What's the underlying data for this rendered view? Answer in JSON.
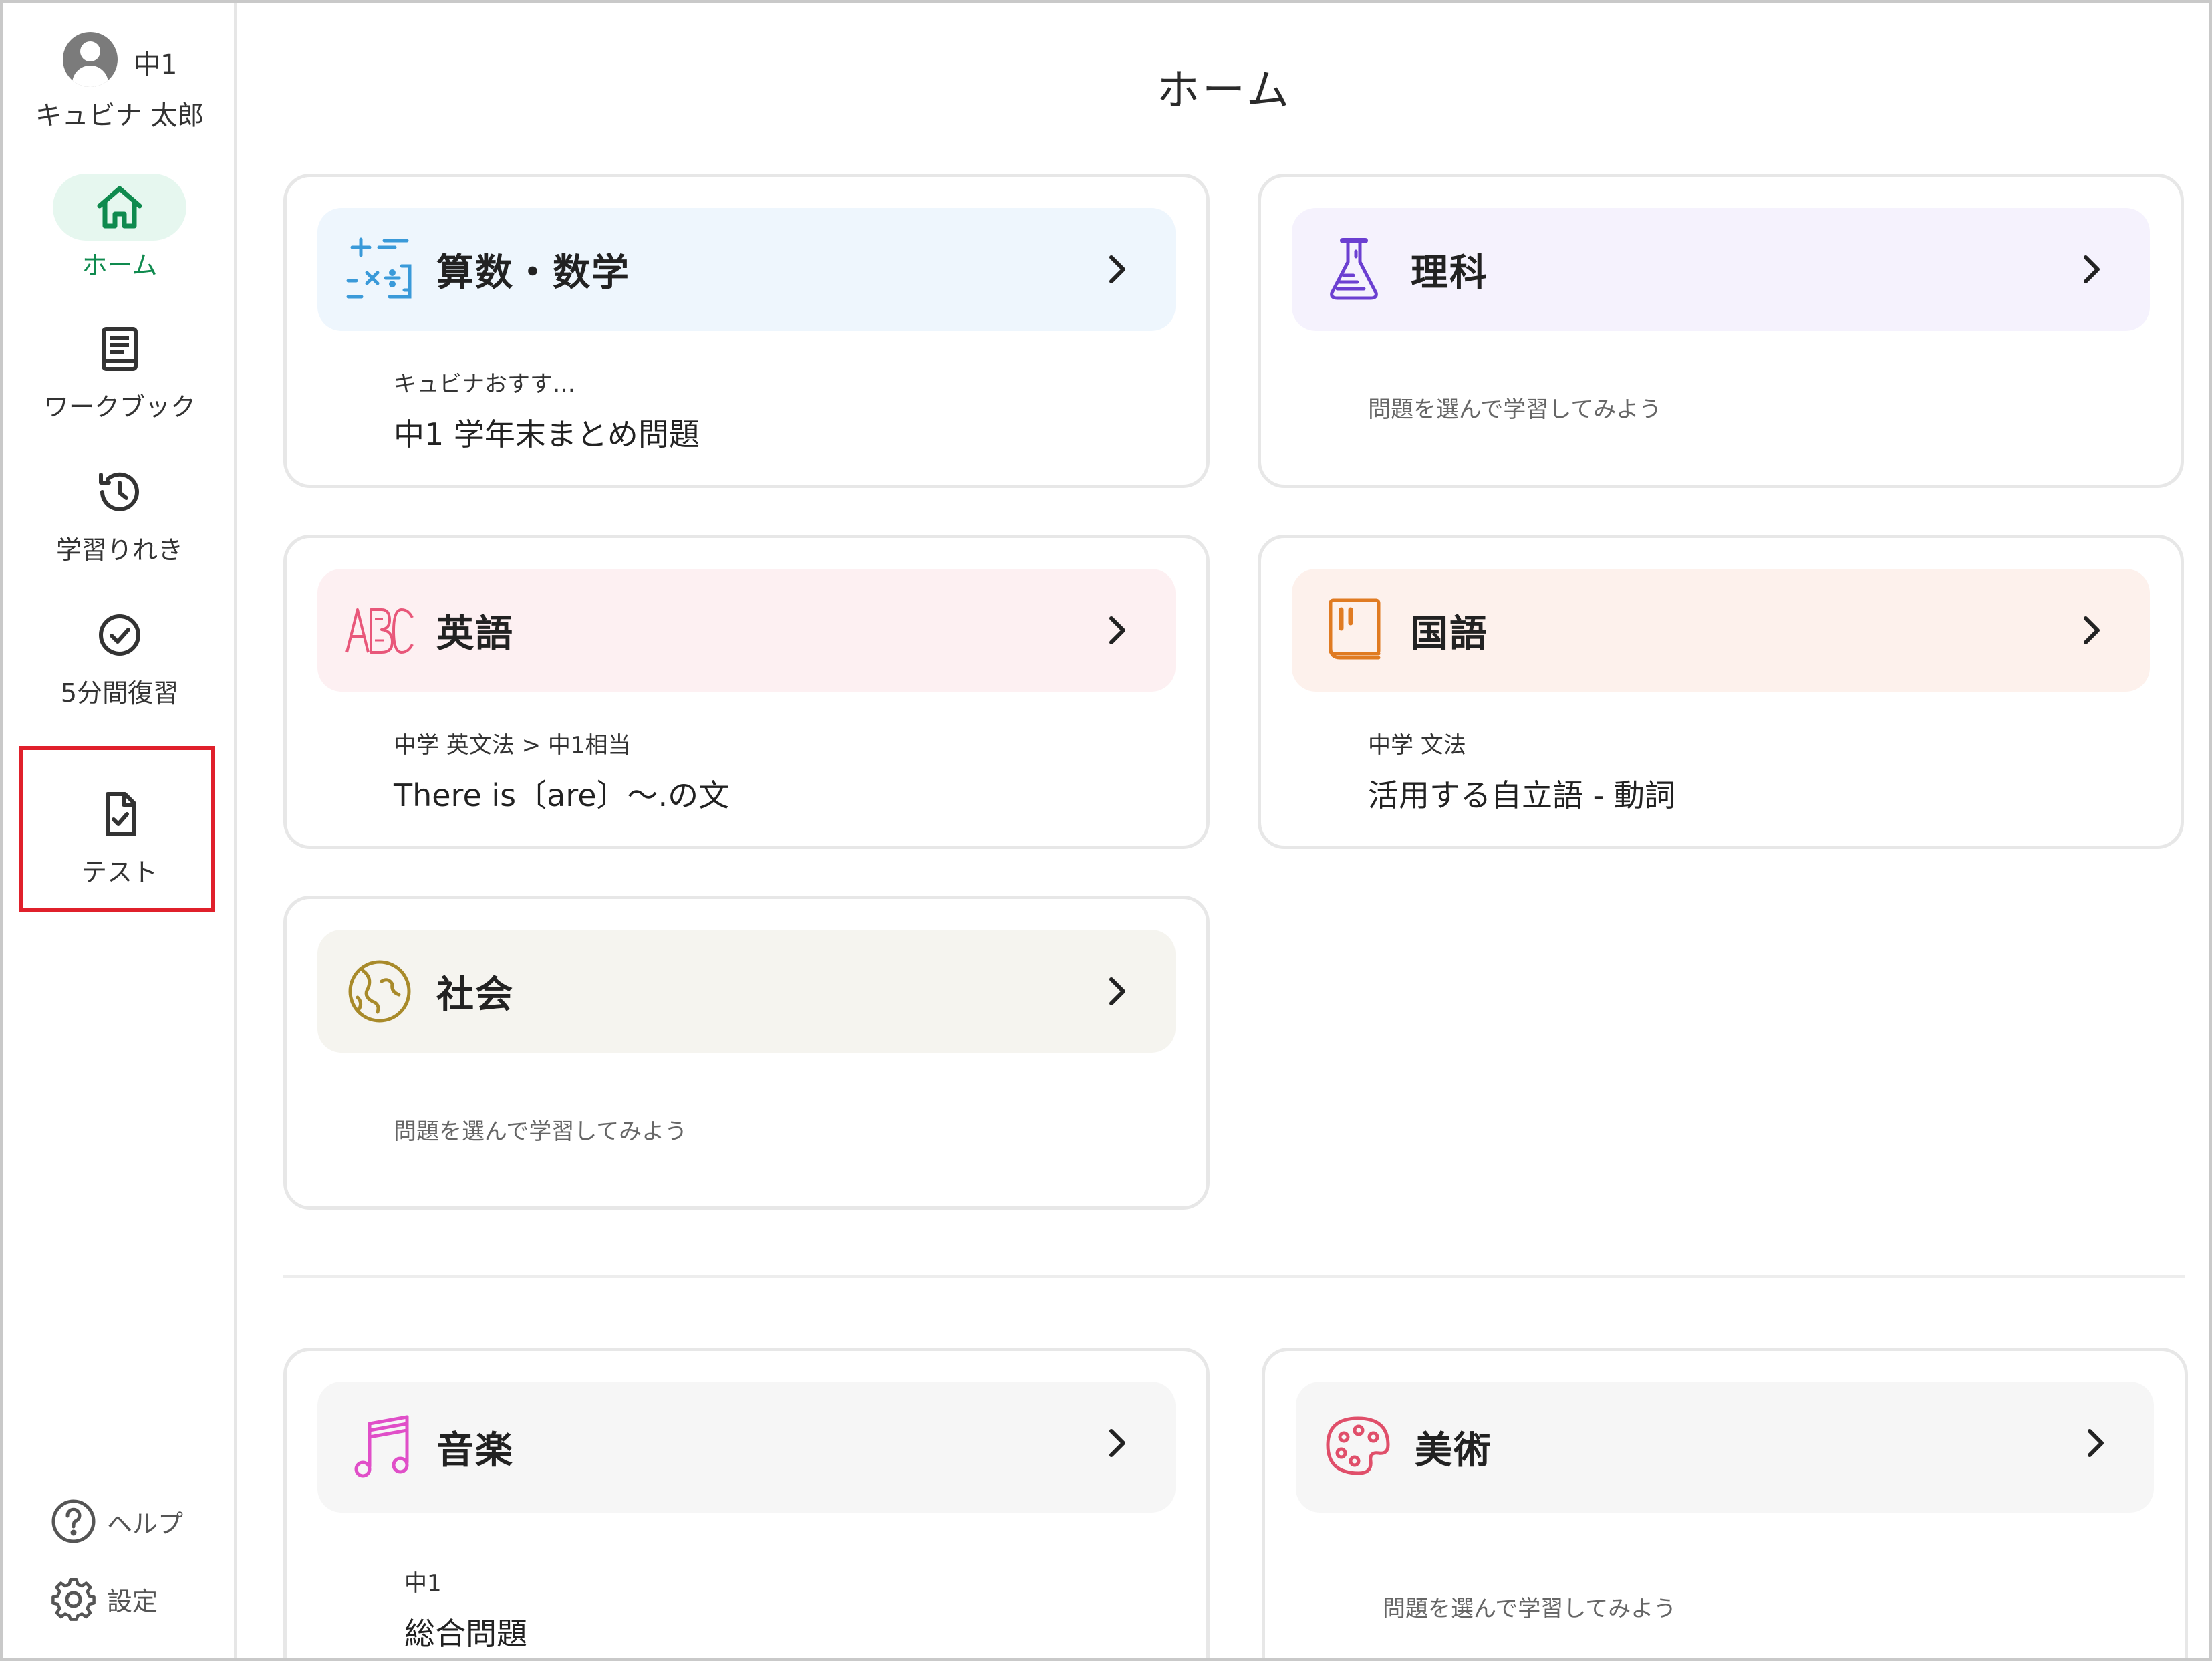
{
  "user": {
    "grade": "中1",
    "name": "キュビナ 太郎"
  },
  "sidebar": {
    "items": [
      {
        "label": "ホーム",
        "icon": "home-icon",
        "active": true
      },
      {
        "label": "ワークブック",
        "icon": "book-icon",
        "active": false
      },
      {
        "label": "学習りれき",
        "icon": "history-icon",
        "active": false
      },
      {
        "label": "5分間復習",
        "icon": "check-circle-icon",
        "active": false
      },
      {
        "label": "テスト",
        "icon": "test-document-icon",
        "active": false
      }
    ],
    "help_label": "ヘルプ",
    "settings_label": "設定"
  },
  "page": {
    "title": "ホーム"
  },
  "subjects": [
    {
      "name": "算数・数学",
      "icon": "math-icon",
      "color": "#eef6fd",
      "sub": "キュビナおすす…",
      "text": "中1 学年末まとめ問題",
      "empty": ""
    },
    {
      "name": "理科",
      "icon": "flask-icon",
      "color": "#f5f2fd",
      "sub": "",
      "text": "",
      "empty": "問題を選んで学習してみよう"
    },
    {
      "name": "英語",
      "icon": "abc-icon",
      "color": "#fdf0f2",
      "sub": "中学 英文法 > 中1相当",
      "text": "There is〔are〕～.の文",
      "empty": ""
    },
    {
      "name": "国語",
      "icon": "japanese-book-icon",
      "color": "#fdf1ec",
      "sub": "中学 文法",
      "text": "活用する自立語 - 動詞",
      "empty": ""
    },
    {
      "name": "社会",
      "icon": "globe-icon",
      "color": "#f5f4ef",
      "sub": "",
      "text": "",
      "empty": "問題を選んで学習してみよう"
    },
    {
      "name": "音楽",
      "icon": "music-icon",
      "color": "#f6f6f6",
      "sub": "中1",
      "text": "総合問題",
      "empty": ""
    },
    {
      "name": "美術",
      "icon": "palette-icon",
      "color": "#f6f6f6",
      "sub": "",
      "text": "",
      "empty": "問題を選んで学習してみよう"
    }
  ],
  "colors": {
    "accent": "#0f8a4e",
    "highlight": "#e0202b"
  }
}
